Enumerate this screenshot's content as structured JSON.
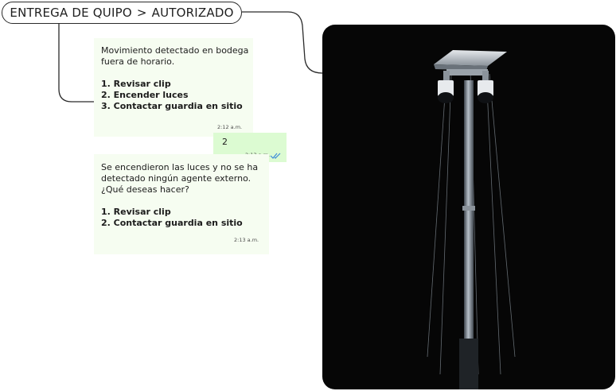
{
  "breadcrumb": {
    "parent": "ENTREGA DE QUIPO",
    "separator": ">",
    "current": "AUTORIZADO"
  },
  "chat": {
    "message_1": {
      "lines": [
        "Movimiento detectado en bodega",
        "fuera de horario."
      ],
      "options": [
        "1. Revisar clip",
        "2. Encender luces",
        "3. Contactar guardia en sitio"
      ],
      "time": "2:12 a.m."
    },
    "reply": {
      "text": "2",
      "time": "2:13 a.m.",
      "status_icon": "double-check-icon",
      "status_color": "#3b8ad9"
    },
    "message_2": {
      "lines": [
        "Se encendieron las luces y no se ha",
        "detectado ningún agente externo.",
        "¿Qué deseas hacer?"
      ],
      "options": [
        "1. Revisar clip",
        "2. Contactar guardia en sitio"
      ],
      "time": "2:13 a.m."
    }
  },
  "colors": {
    "incoming_bubble": "#f6fdf1",
    "outgoing_bubble": "#dcfbd2",
    "photo_background": "#060606",
    "connector_line": "#2a2a2a"
  }
}
